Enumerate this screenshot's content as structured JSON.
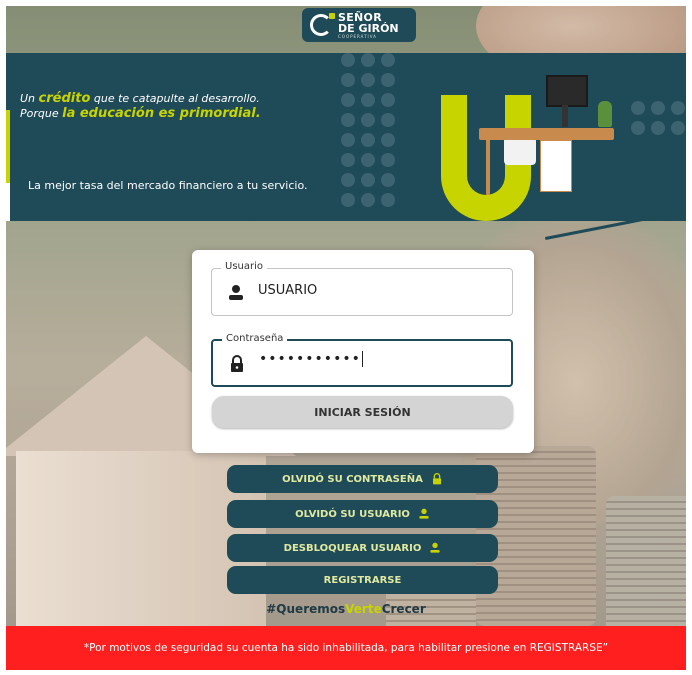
{
  "logo": {
    "line1": "SEÑOR",
    "line2": "DE GIRÓN",
    "line3": "COOPERATIVA"
  },
  "banner": {
    "line1_pre": "Un ",
    "line1_highlight": "crédito",
    "line1_post": " que te catapulte al desarrollo.",
    "line2_pre": "Porque ",
    "line2_highlight": "la educación es primordial.",
    "tagline": "La mejor tasa del mercado financiero a tu servicio."
  },
  "login": {
    "user_legend": "Usuario",
    "user_value": "USUARIO",
    "pass_legend": "Contraseña",
    "pass_value": "•••••••••••",
    "submit_label": "INICIAR SESIÓN"
  },
  "actions": {
    "forgot_password": "OLVIDÓ SU CONTRASEÑA",
    "forgot_user": "OLVIDÓ SU USUARIO",
    "unlock_user": "DESBLOQUEAR USUARIO",
    "register": "REGISTRARSE"
  },
  "hashtag": {
    "part1": "#Queremos",
    "part2": "Verte",
    "part3": "Crecer"
  },
  "alert": "*Por motivos de seguridad su cuenta ha sido inhabilitada, para habilitar presione en REGISTRARSE”",
  "colors": {
    "brand": "#1f4a57",
    "accent": "#c8d400",
    "alert": "#ff1f1f"
  },
  "icons": {
    "user": "person-icon",
    "lock": "lock-icon"
  }
}
